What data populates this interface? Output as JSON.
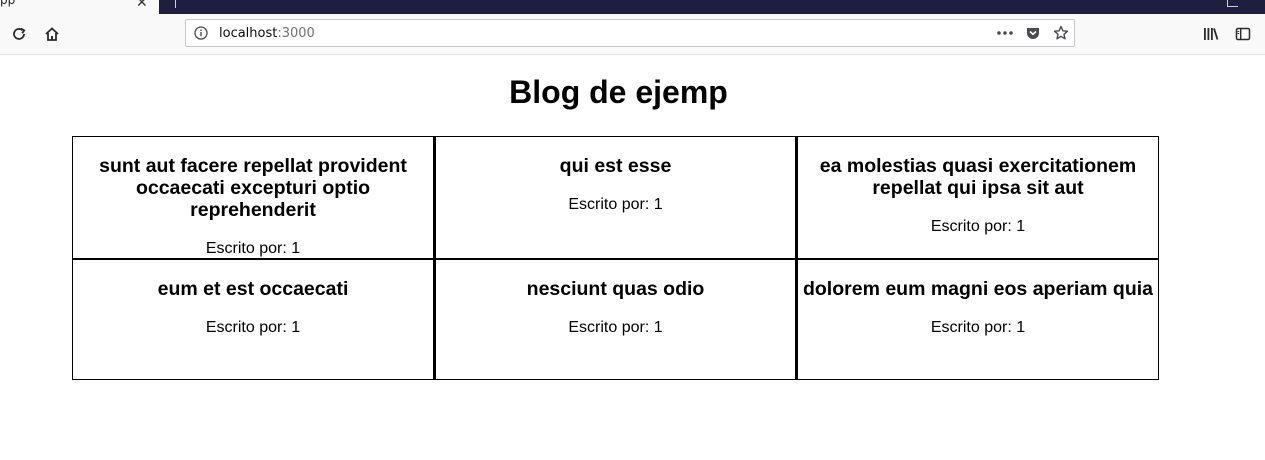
{
  "browser": {
    "tab_title": "pp",
    "tab_close": "✕",
    "url_host": "localhost",
    "url_port": ":3000"
  },
  "page": {
    "title": "Blog de ejemp"
  },
  "posts": [
    {
      "title": "sunt aut facere repellat provident occaecati excepturi optio reprehenderit",
      "author": "Escrito por: 1"
    },
    {
      "title": "qui est esse",
      "author": "Escrito por: 1"
    },
    {
      "title": "ea molestias quasi exercitationem repellat qui ipsa sit aut",
      "author": "Escrito por: 1"
    },
    {
      "title": "eum et est occaecati",
      "author": "Escrito por: 1"
    },
    {
      "title": "nesciunt quas odio",
      "author": "Escrito por: 1"
    },
    {
      "title": "dolorem eum magni eos aperiam quia",
      "author": "Escrito por: 1"
    }
  ],
  "icons": {
    "reload": "reload-icon",
    "home": "home-icon",
    "info": "info-icon",
    "more": "more-actions-icon",
    "pocket": "pocket-icon",
    "bookmark": "bookmark-star-icon",
    "library": "library-icon",
    "sidebar": "sidebar-icon"
  }
}
